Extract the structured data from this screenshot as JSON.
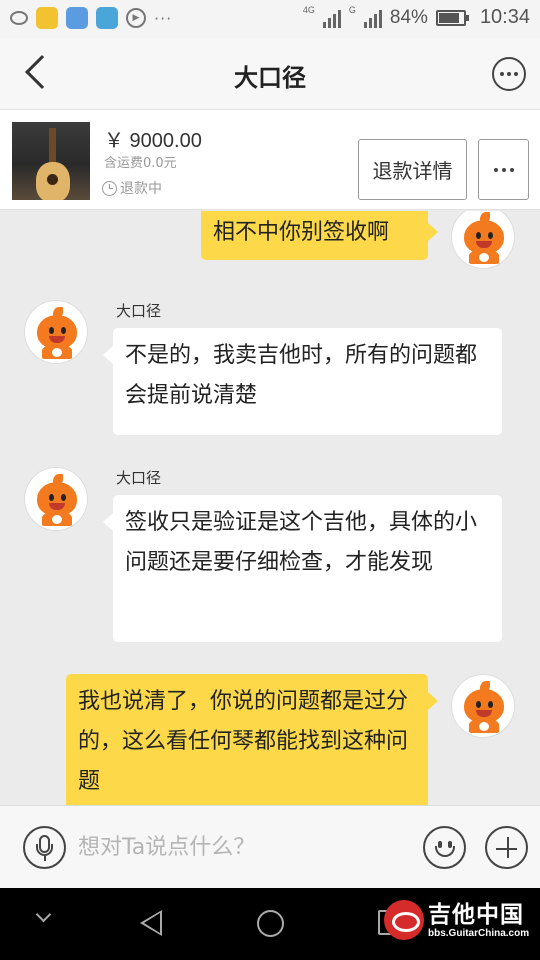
{
  "status_bar": {
    "network": "4G",
    "network2": "G",
    "battery_percent": "84%",
    "battery_level": 0.84,
    "time": "10:34"
  },
  "header": {
    "title": "大口径"
  },
  "product": {
    "price": "￥ 9000.00",
    "shipping": "含运费0.0元",
    "status": "退款中",
    "refund_button": "退款详情"
  },
  "messages": [
    {
      "side": "right",
      "text": "相不中你别签收啊"
    },
    {
      "side": "left",
      "sender": "大口径",
      "text": "不是的，我卖吉他时，所有的问题都会提前说清楚"
    },
    {
      "side": "left",
      "sender": "大口径",
      "text": "签收只是验证是这个吉他，具体的小问题还是要仔细检查，才能发现"
    },
    {
      "side": "right",
      "text": "我也说清了，你说的问题都是过分的，这么看任何琴都能找到这种问题"
    }
  ],
  "input": {
    "placeholder": "想对Ta说点什么？"
  },
  "watermark": {
    "title": "吉他中国",
    "url": "bbs.GuitarChina.com"
  }
}
